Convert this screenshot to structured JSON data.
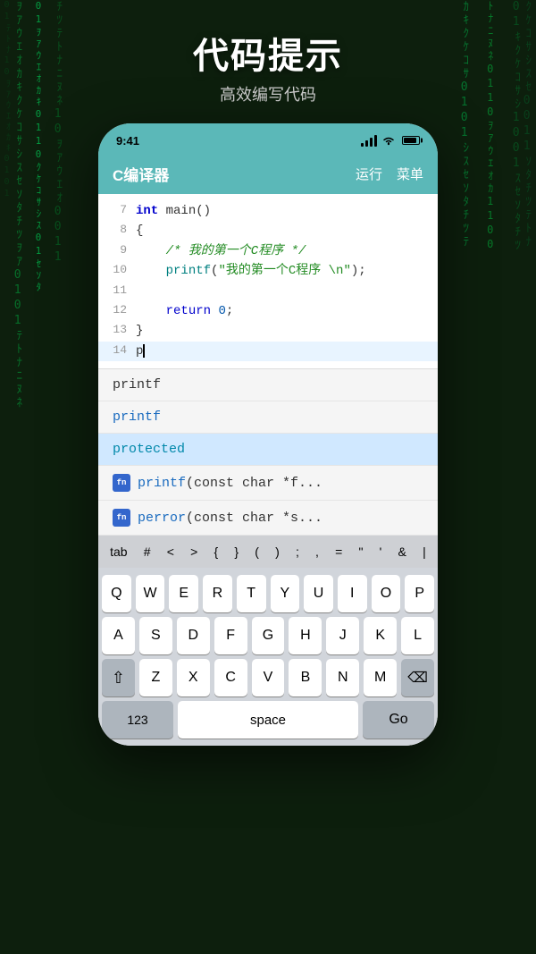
{
  "background": {
    "color": "#0d1f0d"
  },
  "header": {
    "main_title": "代码提示",
    "sub_title": "高效编写代码"
  },
  "status_bar": {
    "time": "9:41",
    "signal": "▲▲▲",
    "wifi": "wifi",
    "battery": "battery"
  },
  "toolbar": {
    "app_title": "C编译器",
    "run_label": "运行",
    "menu_label": "菜单"
  },
  "code_editor": {
    "lines": [
      {
        "num": "7",
        "text": "int main()"
      },
      {
        "num": "8",
        "text": "{"
      },
      {
        "num": "9",
        "text": "    /* 我的第一个C程序 */"
      },
      {
        "num": "10",
        "text": "    printf(\"我的第一个C程序 \\n\");"
      },
      {
        "num": "11",
        "text": ""
      },
      {
        "num": "12",
        "text": "    return 0;"
      },
      {
        "num": "13",
        "text": "}"
      },
      {
        "num": "14",
        "text": "p"
      }
    ]
  },
  "autocomplete": {
    "items": [
      {
        "id": 1,
        "label": "printf",
        "type": "plain",
        "icon": false
      },
      {
        "id": 2,
        "label": "printf",
        "type": "blue",
        "icon": false
      },
      {
        "id": 3,
        "label": "protected",
        "type": "teal",
        "icon": false,
        "selected": true
      },
      {
        "id": 4,
        "label": "printf",
        "suffix": "(const char *f...",
        "type": "icon"
      },
      {
        "id": 5,
        "label": "perror",
        "suffix": "(const char *s...",
        "type": "icon"
      }
    ]
  },
  "shortcut_bar": {
    "keys": [
      "tab",
      "#",
      "<",
      ">",
      "{",
      "}",
      "(",
      ")",
      ";",
      ",",
      "=",
      "\"",
      "'",
      "&",
      "|"
    ]
  },
  "keyboard": {
    "row1": [
      "Q",
      "W",
      "E",
      "R",
      "T",
      "Y",
      "U",
      "I",
      "O",
      "P"
    ],
    "row2": [
      "A",
      "S",
      "D",
      "F",
      "G",
      "H",
      "J",
      "K",
      "L"
    ],
    "row3": [
      "Z",
      "X",
      "C",
      "V",
      "B",
      "N",
      "M"
    ],
    "space_label": "space",
    "num_label": "123",
    "go_label": "Go"
  }
}
